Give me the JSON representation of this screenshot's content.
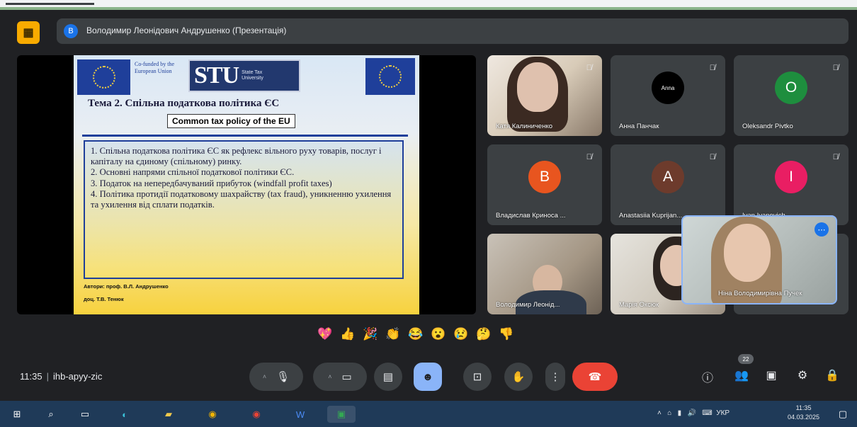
{
  "meeting": {
    "presenter_title": "Володимир Леонідович Андрушенко (Презентація)",
    "presenter_initial": "В",
    "app_icon_glyph": "▦"
  },
  "slide": {
    "left_eu_text": "Co-funded by the European Union",
    "stu_logo": "STU",
    "stu_subtitle": "State Tax University",
    "heading": "Тема 2. Спільна податкова політика ЄС",
    "subheading": "Common tax policy of the EU",
    "body_1": "1. Спільна податкова політика ЄС як рефлекс вільного руху товарів, послуг і капіталу на єдиному (спільному) ринку.",
    "body_2": "2. Основні напрями спільної податкової політики ЄС.",
    "body_3": "3. Податок на непередбачуваний прибуток (windfall profit taxes)",
    "body_4": "4. Політика протидії податковому шахрайству (tax fraud), уникненню ухилення та ухилення від сплати податків.",
    "author_1": "Автори: проф. В.Л. Андрушенко",
    "author_2": "доц. Т.В. Тенюк"
  },
  "participants": [
    {
      "name": "Катя Калиниченко",
      "type": "video"
    },
    {
      "name": "Анна Панчак",
      "type": "avatar",
      "initial": "Anna",
      "color": "#000000"
    },
    {
      "name": "Oleksandr Pivtko",
      "type": "avatar",
      "initial": "O",
      "color": "#1e8e3e"
    },
    {
      "name": "Владислав Криноса ...",
      "type": "avatar",
      "initial": "B",
      "color": "#e8551f"
    },
    {
      "name": "Anastasiia Kuprijan...",
      "type": "avatar",
      "initial": "A",
      "color": "#6d3b2c"
    },
    {
      "name": "Ivan Ivanovich",
      "type": "avatar",
      "initial": "I",
      "color": "#e91e63"
    },
    {
      "name": "Володимир Леонід...",
      "type": "video"
    },
    {
      "name": "Марія Оксюк",
      "type": "video"
    }
  ],
  "pip": {
    "name": "Ніна Володимирівна Пучек",
    "more_glyph": "⋯"
  },
  "reactions": [
    "💖",
    "👍",
    "🎉",
    "👏",
    "😂",
    "😮",
    "😢",
    "🤔",
    "👎"
  ],
  "controls": {
    "time": "11:35",
    "meeting_code": "ihb-apyy-zic",
    "participants_badge": "22"
  },
  "taskbar": {
    "lang": "УКР",
    "clock_time": "11:35",
    "clock_date": "04.03.2025"
  }
}
